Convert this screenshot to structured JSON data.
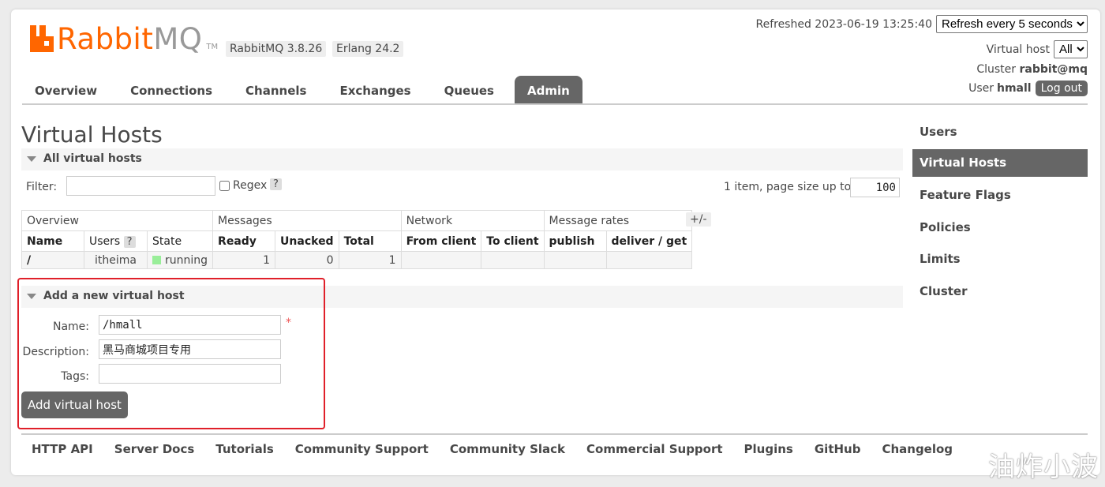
{
  "brand": {
    "rabbit": "Rabbit",
    "mq": "MQ",
    "tm": "TM",
    "version": "RabbitMQ 3.8.26",
    "erlang": "Erlang 24.2"
  },
  "tabs": [
    "Overview",
    "Connections",
    "Channels",
    "Exchanges",
    "Queues",
    "Admin"
  ],
  "header": {
    "refreshed": "Refreshed 2023-06-19 13:25:40",
    "refresh_option": "Refresh every 5 seconds",
    "vhost_label": "Virtual host",
    "vhost_value": "All",
    "cluster_label": "Cluster",
    "cluster_value": "rabbit@mq",
    "user_label": "User",
    "user_value": "hmall",
    "logout": "Log out"
  },
  "page_title": "Virtual Hosts",
  "all_section": {
    "title": "All virtual hosts",
    "filter_label": "Filter:",
    "filter_value": "",
    "regex_label": "Regex",
    "help": "?",
    "pagination": "1 item, page size up to",
    "page_size": "100",
    "plusminus": "+/-"
  },
  "table": {
    "groups": [
      "Overview",
      "Messages",
      "Network",
      "Message rates"
    ],
    "columns": [
      "Name",
      "Users",
      "State",
      "Ready",
      "Unacked",
      "Total",
      "From client",
      "To client",
      "publish",
      "deliver / get"
    ],
    "rows": [
      {
        "name": "/",
        "users": "itheima",
        "state": "running",
        "ready": "1",
        "unacked": "0",
        "total": "1"
      }
    ]
  },
  "add_section": {
    "title": "Add a new virtual host",
    "name_label": "Name:",
    "name_value": "/hmall",
    "required_mark": "*",
    "desc_label": "Description:",
    "desc_value": "黑马商城项目专用",
    "tags_label": "Tags:",
    "tags_value": "",
    "button": "Add virtual host"
  },
  "right_nav": [
    "Users",
    "Virtual Hosts",
    "Feature Flags",
    "Policies",
    "Limits",
    "Cluster"
  ],
  "footer": [
    "HTTP API",
    "Server Docs",
    "Tutorials",
    "Community Support",
    "Community Slack",
    "Commercial Support",
    "Plugins",
    "GitHub",
    "Changelog"
  ],
  "watermark": "油炸小波",
  "colors": {
    "brand_orange": "#ff6600",
    "active_tab": "#666666",
    "highlight_box": "#e0202a",
    "running": "#99ee99"
  }
}
